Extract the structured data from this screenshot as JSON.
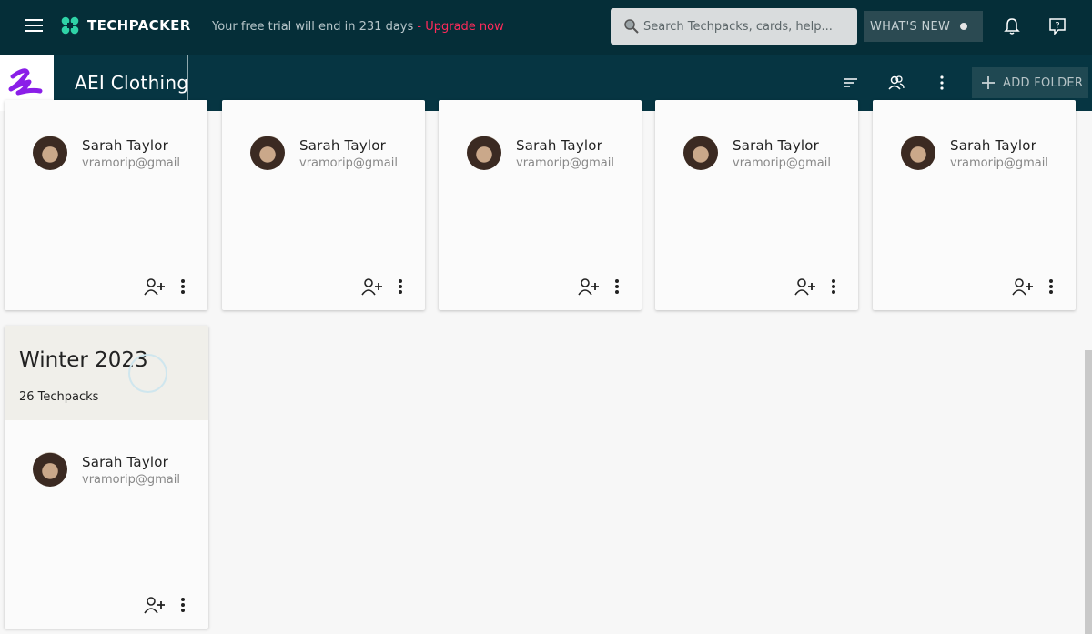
{
  "app": {
    "brand": "TECHPACKER",
    "trial_text": "Your free trial will end in 231 days",
    "upgrade_text": "- Upgrade now",
    "search_placeholder": "Search Techpacks, cards, help...",
    "whats_new": "WHAT'S NEW"
  },
  "workspace": {
    "name": "AEI Clothing",
    "add_folder": "ADD FOLDER"
  },
  "folders_row1": [
    {
      "member_name": "Sarah Taylor",
      "member_email": "vramorip@gmail"
    },
    {
      "member_name": "Sarah Taylor",
      "member_email": "vramorip@gmail"
    },
    {
      "member_name": "Sarah Taylor",
      "member_email": "vramorip@gmail"
    },
    {
      "member_name": "Sarah Taylor",
      "member_email": "vramorip@gmail"
    },
    {
      "member_name": "Sarah Taylor",
      "member_email": "vramorip@gmail"
    }
  ],
  "winter_folder": {
    "title": "Winter 2023",
    "count": "26 Techpacks",
    "member_name": "Sarah Taylor",
    "member_email": "vramorip@gmail"
  },
  "icons": [
    "menu-icon",
    "techpacker-logo-icon",
    "search-icon",
    "bell-icon",
    "help-icon",
    "sort-icon",
    "members-icon",
    "more-vert-icon",
    "plus-icon",
    "add-member-icon"
  ],
  "colors": {
    "topbar": "#052e38",
    "subbar": "#063542",
    "upgrade": "#ff2a5a",
    "logo": "#2fd3a7"
  }
}
